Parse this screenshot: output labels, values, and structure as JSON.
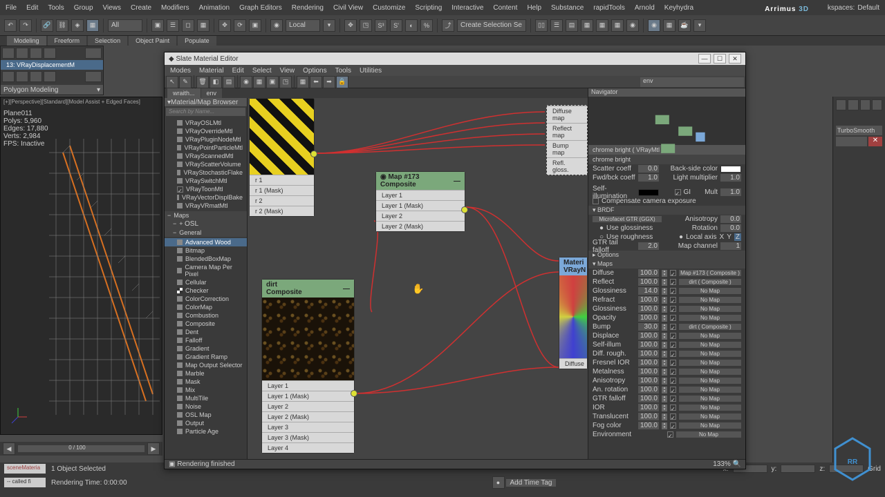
{
  "menubar": {
    "items": [
      "File",
      "Edit",
      "Tools",
      "Group",
      "Views",
      "Create",
      "Modifiers",
      "Animation",
      "Graph Editors",
      "Rendering",
      "Civil View",
      "Customize",
      "Scripting",
      "Interactive",
      "Content",
      "Help",
      "Substance",
      "rapidTools",
      "Arnold",
      "Keyhydra"
    ],
    "logo_a": "Arrimus ",
    "logo_b": "3D",
    "wkspc_lbl": "kspaces:",
    "wkspc_val": "Default"
  },
  "toolbar": {
    "filter": "All",
    "coord": "Local",
    "sel_set": "Create Selection Se"
  },
  "tabs": [
    "Modeling",
    "Freeform",
    "Selection",
    "Object Paint",
    "Populate"
  ],
  "left": {
    "mod_title": "13: VRayDisplacementM",
    "mod_drop": "Polygon Modeling"
  },
  "viewport": {
    "label": "[+][Perspective][Standard][Model Assist + Edged Faces]",
    "obj": "Plane011",
    "polys_lbl": "Polys:",
    "polys": "5,960",
    "edges_lbl": "Edges:",
    "edges": "17,880",
    "verts_lbl": "Verts:",
    "verts": "2,984",
    "fps_lbl": "FPS:",
    "fps": "Inactive"
  },
  "timeline": {
    "frame": "0 / 100"
  },
  "status": {
    "log1": "sceneMateria",
    "log2": "-- called fi",
    "sel": "1 Object Selected",
    "render": "Rendering Time: 0:00:00",
    "finished": "Rendering finished",
    "add_tag": "Add Time Tag",
    "x": "x:",
    "y": "y:",
    "z": "z:",
    "grid": "Grid"
  },
  "slate": {
    "title": "Slate Material Editor",
    "menus": [
      "Modes",
      "Material",
      "Edit",
      "Select",
      "View",
      "Options",
      "Tools",
      "Utilities"
    ],
    "tabs": [
      "wraith...",
      "env"
    ],
    "browser_hdr": "Material/Map Browser",
    "search_ph": "Search by Name...",
    "nav_hdr": "Navigator",
    "foot_left": "Rendering finished",
    "foot_zoom": "133%",
    "search_top": "env"
  },
  "browser": {
    "vray_items": [
      "VRayOSLMtl",
      "VRayOverrideMtl",
      "VRayPluginNodeMtl",
      "VRayPointParticleMtl",
      "VRayScannedMtl",
      "VRayScatterVolume",
      "VRayStochasticFlake",
      "VRaySwitchMtl",
      "VRayToonMtl",
      "VRayVectorDisplBake",
      "VRayVRmatMtl"
    ],
    "cats": [
      "Maps",
      "OSL",
      "General"
    ],
    "gen_items": [
      "Advanced Wood",
      "Bitmap",
      "BlendedBoxMap",
      "Camera Map Per Pixel",
      "Cellular",
      "Checker",
      "ColorCorrection",
      "ColorMap",
      "Combustion",
      "Composite",
      "Dent",
      "Falloff",
      "Gradient",
      "Gradient Ramp",
      "Map Output Selector",
      "Marble",
      "Mask",
      "Mix",
      "MultiTile",
      "Noise",
      "OSL Map",
      "Output",
      "Particle Age"
    ]
  },
  "nodes": {
    "hazard": {
      "rows": [
        "r 1",
        "r 1 (Mask)",
        "r 2",
        "r 2 (Mask)"
      ]
    },
    "comp": {
      "title": "Map #173",
      "sub": "Composite",
      "rows": [
        "Layer 1",
        "Layer 1 (Mask)",
        "Layer 2",
        "Layer 2 (Mask)"
      ]
    },
    "dirt": {
      "title": "dirt",
      "sub": "Composite",
      "rows": [
        "Layer 1",
        "Layer 1 (Mask)",
        "Layer 2",
        "Layer 2 (Mask)",
        "Layer 3",
        "Layer 3 (Mask)",
        "Layer 4"
      ]
    },
    "mat": {
      "title": "Materi",
      "sub": "VRayN",
      "diffuse": "Diffuse"
    },
    "mtl_ports": [
      "Diffuse map",
      "Reflect map",
      "Bump map",
      "Refl. gloss."
    ]
  },
  "params": {
    "hdr": "chrome bright  ( VRayMtl )",
    "name": "chrome bright",
    "scatter_lbl": "Scatter coeff",
    "scatter_v": "0.0",
    "fwd_lbl": "Fwd/bck coeff",
    "fwd_v": "1.0",
    "bside_lbl": "Back-side color",
    "lmult_lbl": "Light multiplier",
    "lmult_v": "1.0",
    "si_lbl": "Self-illumination",
    "gi": "GI",
    "mult": "Mult",
    "mult_v": "1.0",
    "comp_lbl": "Compensate camera exposure",
    "brdf": "BRDF",
    "brdf_drop": "Microfacet GTR (GGX)",
    "aniso_lbl": "Anisotropy",
    "aniso_v": "0.0",
    "rot_lbl": "Rotation",
    "rot_v": "0.0",
    "localax_lbl": "Local axis",
    "x": "X",
    "y": "Y",
    "z": "Z",
    "glos_lbl": "Use glossiness",
    "rough_lbl": "Use roughness",
    "gtr_lbl": "GTR tail falloff",
    "gtr_v": "2.0",
    "mapch_lbl": "Map channel",
    "mapch_v": "1",
    "options": "Options",
    "maps_sect": "Maps",
    "maps": [
      {
        "name": "Diffuse",
        "amt": "100.0",
        "on": true,
        "slot": "Map #173  ( Composite )"
      },
      {
        "name": "Reflect",
        "amt": "100.0",
        "on": true,
        "slot": "dirt  ( Composite )"
      },
      {
        "name": "Glossiness",
        "amt": "14.0",
        "on": true,
        "slot": "No Map"
      },
      {
        "name": "Refract",
        "amt": "100.0",
        "on": true,
        "slot": "No Map"
      },
      {
        "name": "Glossiness",
        "amt": "100.0",
        "on": true,
        "slot": "No Map"
      },
      {
        "name": "Opacity",
        "amt": "100.0",
        "on": true,
        "slot": "No Map"
      },
      {
        "name": "Bump",
        "amt": "30.0",
        "on": true,
        "slot": "dirt  ( Composite )"
      },
      {
        "name": "Displace",
        "amt": "100.0",
        "on": true,
        "slot": "No Map"
      },
      {
        "name": "Self-illum",
        "amt": "100.0",
        "on": true,
        "slot": "No Map"
      },
      {
        "name": "Diff. rough.",
        "amt": "100.0",
        "on": true,
        "slot": "No Map"
      },
      {
        "name": "Fresnel IOR",
        "amt": "100.0",
        "on": true,
        "slot": "No Map"
      },
      {
        "name": "Metalness",
        "amt": "100.0",
        "on": true,
        "slot": "No Map"
      },
      {
        "name": "Anisotropy",
        "amt": "100.0",
        "on": true,
        "slot": "No Map"
      },
      {
        "name": "An. rotation",
        "amt": "100.0",
        "on": true,
        "slot": "No Map"
      },
      {
        "name": "GTR falloff",
        "amt": "100.0",
        "on": true,
        "slot": "No Map"
      },
      {
        "name": "IOR",
        "amt": "100.0",
        "on": true,
        "slot": "No Map"
      },
      {
        "name": "Translucent",
        "amt": "100.0",
        "on": true,
        "slot": "No Map"
      },
      {
        "name": "Fog color",
        "amt": "100.0",
        "on": true,
        "slot": "No Map"
      },
      {
        "name": "Environment",
        "amt": "",
        "on": true,
        "slot": "No Map"
      }
    ]
  },
  "cmd": {
    "turbo": "TurboSmooth"
  }
}
